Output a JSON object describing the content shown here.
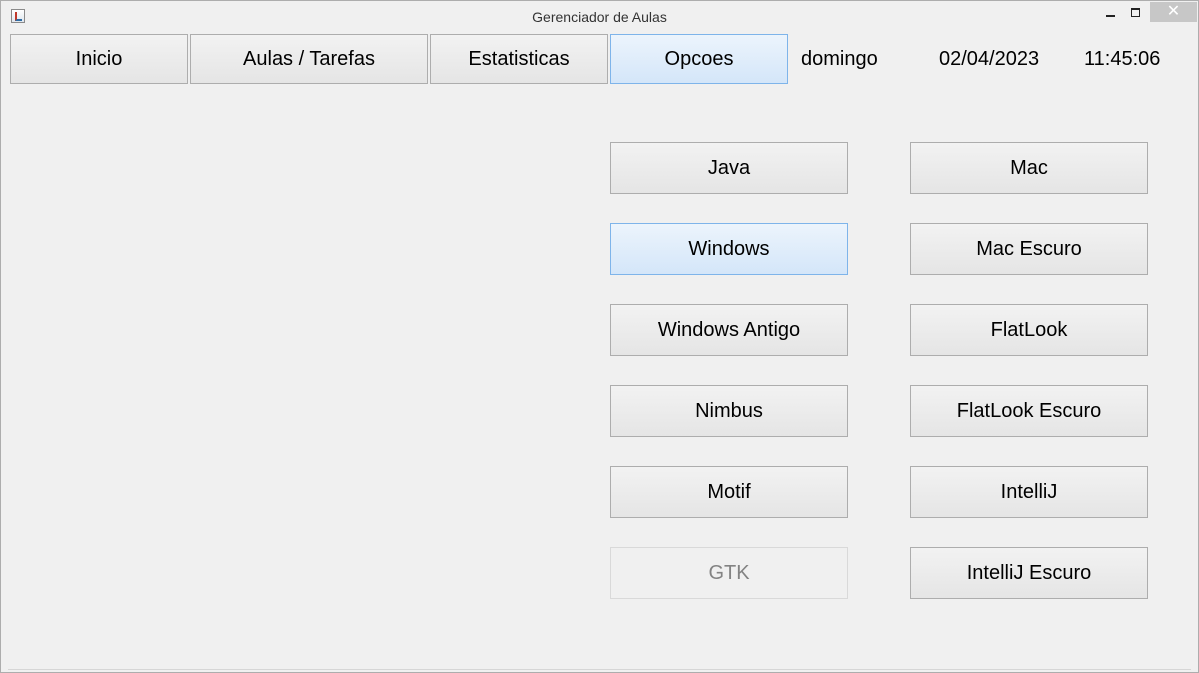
{
  "window": {
    "title": "Gerenciador de Aulas",
    "minimize_glyph": "",
    "close_glyph": "✕"
  },
  "nav": {
    "inicio": "Inicio",
    "aulas": "Aulas / Tarefas",
    "estatisticas": "Estatisticas",
    "opcoes": "Opcoes"
  },
  "info": {
    "day": "domingo",
    "date": "02/04/2023",
    "time": "11:45:06"
  },
  "themes": {
    "java": "Java",
    "windows": "Windows",
    "windows_antigo": "Windows Antigo",
    "nimbus": "Nimbus",
    "motif": "Motif",
    "gtk": "GTK",
    "mac": "Mac",
    "mac_escuro": "Mac Escuro",
    "flatlook": "FlatLook",
    "flatlook_escuro": "FlatLook Escuro",
    "intellij": "IntelliJ",
    "intellij_escuro": "IntelliJ Escuro"
  },
  "state": {
    "active_tab": "Opcoes",
    "selected_theme": "Windows",
    "disabled_theme": "GTK"
  },
  "colors": {
    "background": "#f0f0f0",
    "selected_border": "#7eb4ea",
    "selected_fill": "#d4e6f9",
    "disabled_text": "#838383"
  },
  "icons": {
    "app": "java-app-icon",
    "minimize": "minimize-icon",
    "maximize": "maximize-icon",
    "close": "close-icon"
  }
}
